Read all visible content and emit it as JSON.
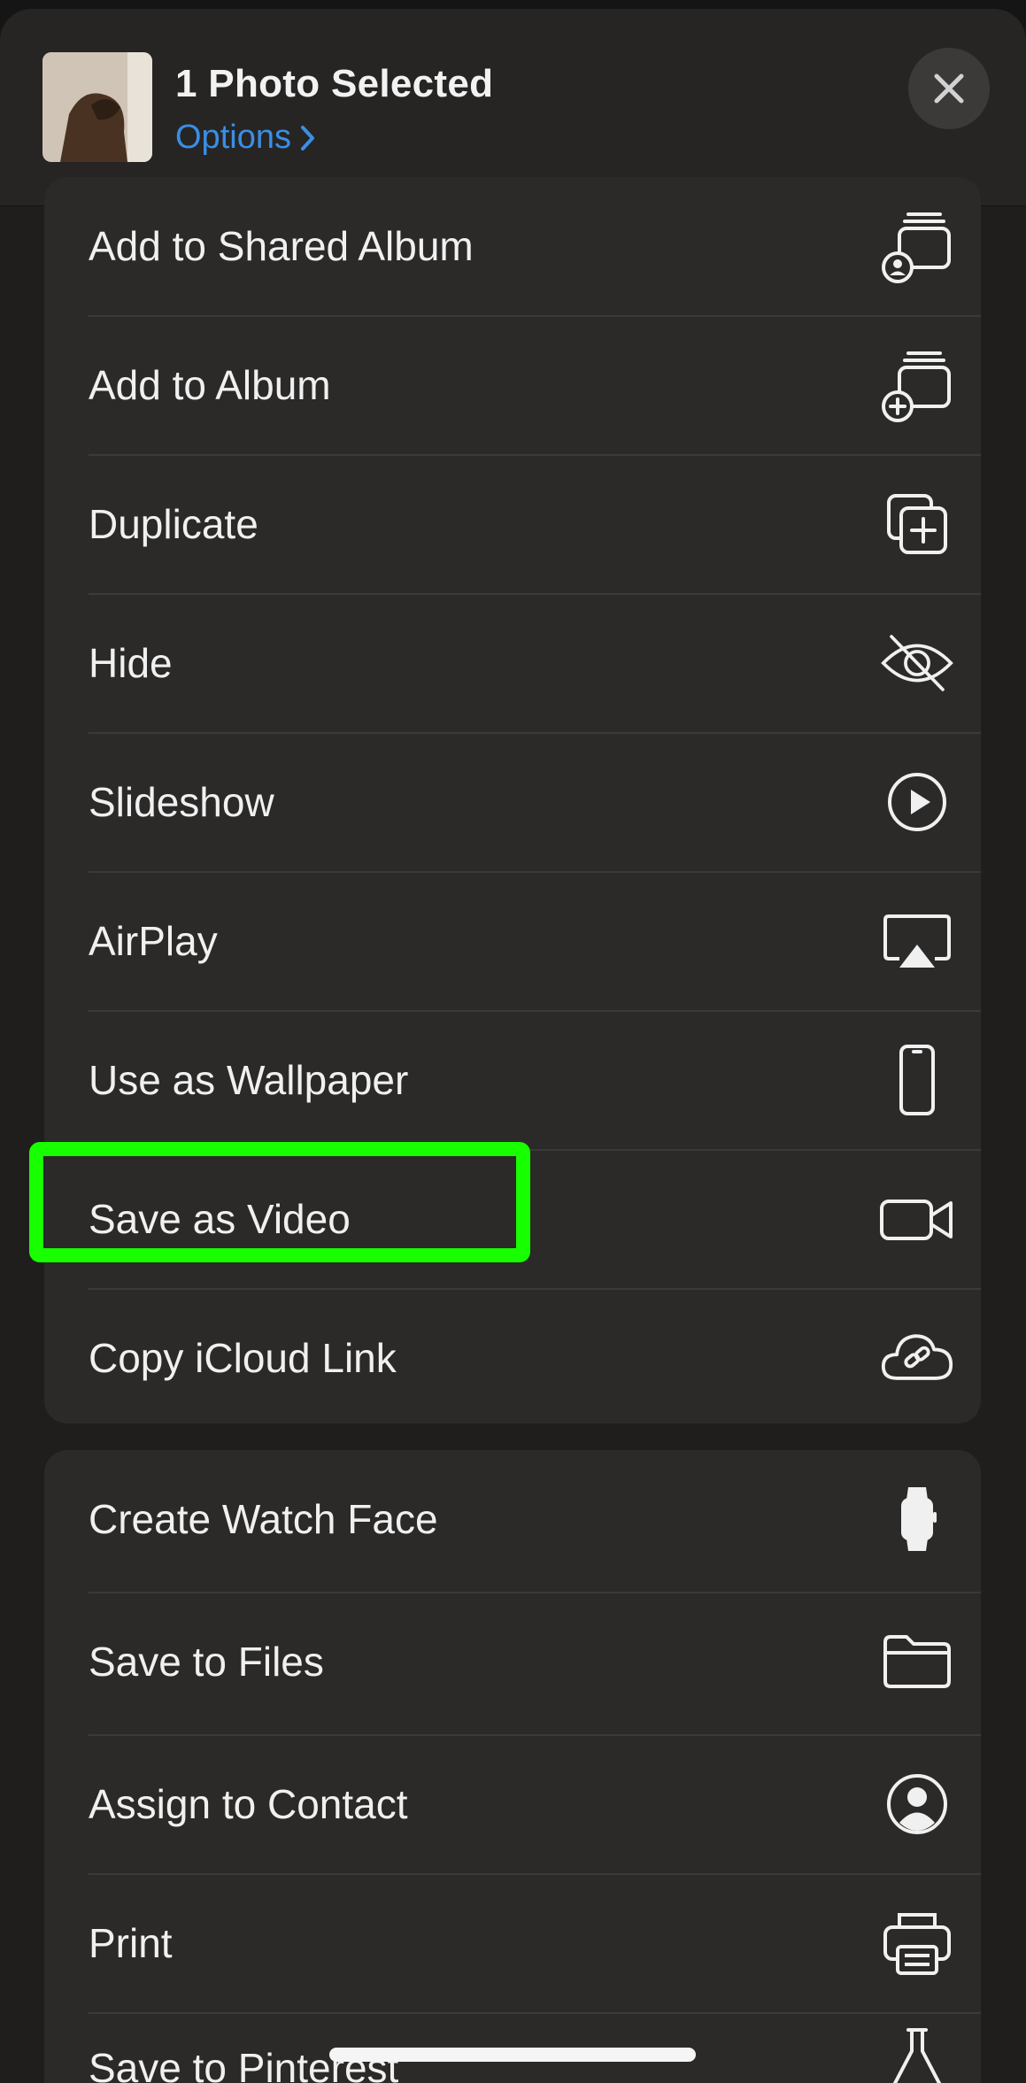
{
  "header": {
    "title": "1 Photo Selected",
    "options_label": "Options",
    "close_icon": "close-icon"
  },
  "actions_group_1": [
    {
      "label": "Add to Shared Album",
      "icon": "shared-album-icon"
    },
    {
      "label": "Add to Album",
      "icon": "add-album-icon"
    },
    {
      "label": "Duplicate",
      "icon": "duplicate-icon"
    },
    {
      "label": "Hide",
      "icon": "eye-slash-icon"
    },
    {
      "label": "Slideshow",
      "icon": "play-circle-icon"
    },
    {
      "label": "AirPlay",
      "icon": "airplay-icon"
    },
    {
      "label": "Use as Wallpaper",
      "icon": "phone-icon"
    },
    {
      "label": "Save as Video",
      "icon": "video-camera-icon"
    },
    {
      "label": "Copy iCloud Link",
      "icon": "cloud-link-icon"
    }
  ],
  "actions_group_2": [
    {
      "label": "Create Watch Face",
      "icon": "watch-icon"
    },
    {
      "label": "Save to Files",
      "icon": "folder-icon"
    },
    {
      "label": "Assign to Contact",
      "icon": "contact-icon"
    },
    {
      "label": "Print",
      "icon": "printer-icon"
    },
    {
      "label": "Save to Pinterest",
      "icon": "flask-icon"
    }
  ],
  "colors": {
    "accent_link": "#3a8ee6",
    "highlight_box": "#18ff00",
    "sheet_bg": "#1f1e1d",
    "group_bg": "#2b2a29"
  }
}
